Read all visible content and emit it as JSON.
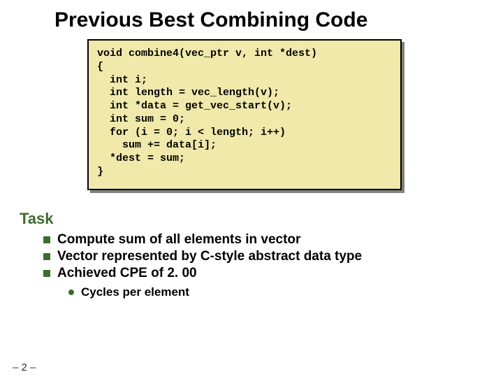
{
  "title": "Previous Best Combining Code",
  "code": "void combine4(vec_ptr v, int *dest)\n{\n  int i;\n  int length = vec_length(v);\n  int *data = get_vec_start(v);\n  int sum = 0;\n  for (i = 0; i < length; i++)\n    sum += data[i];\n  *dest = sum;\n}",
  "section": "Task",
  "bullets": [
    "Compute sum of all elements in vector",
    "Vector represented by C-style abstract data type",
    "Achieved CPE of 2. 00"
  ],
  "subbullet": "Cycles per element",
  "page": "– 2 –"
}
